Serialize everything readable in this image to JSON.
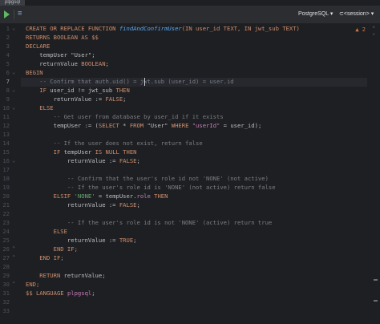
{
  "tab": {
    "label": "plpgsql"
  },
  "toolbar": {
    "dialect": "PostgreSQL",
    "session": "<session>"
  },
  "inspection": {
    "count": "2"
  },
  "gutter": {
    "lines": [
      "1",
      "2",
      "3",
      "4",
      "5",
      "6",
      "7",
      "8",
      "9",
      "10",
      "11",
      "12",
      "13",
      "14",
      "15",
      "16",
      "17",
      "18",
      "19",
      "20",
      "21",
      "22",
      "23",
      "24",
      "25",
      "26",
      "27",
      "28",
      "29",
      "30",
      "31",
      "32",
      "33"
    ],
    "current_line": "7"
  },
  "code": {
    "l1": {
      "a": "CREATE OR REPLACE FUNCTION ",
      "b": "findAndConfirmUser",
      "c": "(IN user_id TEXT, IN jwt_sub TEXT)"
    },
    "l2": "RETURNS BOOLEAN AS $$",
    "l3": "DECLARE",
    "l4": {
      "a": "    tempUser ",
      "b": "\"User\"",
      "c": ";"
    },
    "l5": {
      "a": "    returnValue ",
      "b": "BOOLEAN",
      "c": ";"
    },
    "l6": "BEGIN",
    "l7": "    -- Confirm that auth.uid() = jwt.sub (user_id) = user.id",
    "l8": {
      "a": "    IF ",
      "b": "user_id != jwt_sub",
      "c": " THEN"
    },
    "l9": {
      "a": "        returnValue := ",
      "b": "FALSE",
      "c": ";"
    },
    "l10": "    ELSE",
    "l11": "        -- Get user from database by user_id if it exists",
    "l12": {
      "a": "        tempUser := (",
      "b": "SELECT",
      "c": " * ",
      "d": "FROM",
      "e": " \"User\" ",
      "f": "WHERE",
      "g": " \"userId\"",
      "h": " = user_id);"
    },
    "l13": "",
    "l14": "        -- If the user does not exist, return false",
    "l15": {
      "a": "        IF ",
      "b": "tempUser ",
      "c": "IS NULL THEN"
    },
    "l16": {
      "a": "            returnValue := ",
      "b": "FALSE",
      "c": ";"
    },
    "l17": "",
    "l18": "            -- Confirm that the user's role id not 'NONE' (not active)",
    "l19": "            -- If the user's role id is 'NONE' (not active) return false",
    "l20": {
      "a": "        ELSIF ",
      "b": "'NONE'",
      "c": " = tempUser.",
      "d": "role",
      "e": " THEN"
    },
    "l21": {
      "a": "            returnValue := ",
      "b": "FALSE",
      "c": ";"
    },
    "l22": "",
    "l23": "            -- If the user's role id is not 'NONE' (active) return true",
    "l24": "        ELSE",
    "l25": {
      "a": "            returnValue := ",
      "b": "TRUE",
      "c": ";"
    },
    "l26": "        END IF;",
    "l27": "    END IF;",
    "l28": "",
    "l29": {
      "a": "    RETURN ",
      "b": "returnValue;"
    },
    "l30": "END;",
    "l31": {
      "a": "$$ LANGUAGE ",
      "b": "plpgsql",
      "c": ";"
    },
    "l32": "",
    "l33": ""
  },
  "colors": {
    "keyword": "#cf8e6d",
    "function": "#56a8f5",
    "string": "#6aab73",
    "comment": "#7a7e85",
    "field": "#c77dbb",
    "background": "#1e1f22"
  }
}
